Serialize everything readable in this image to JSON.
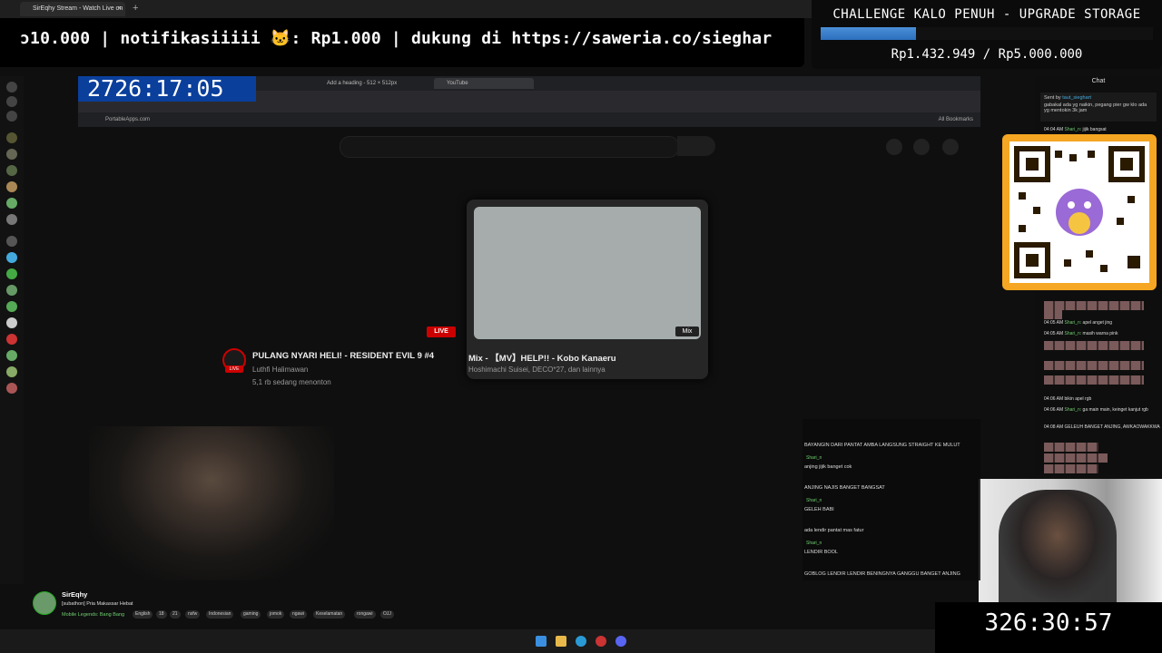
{
  "os_tab": {
    "title": "SirEqhy Stream - Watch Live on Ki",
    "close": "×",
    "new": "+"
  },
  "ticker": {
    "text": "ɔ10.000 | notifikasiiiii 🐱: Rp1.000 |  dukung di https://saweria.co/sieghar"
  },
  "challenge": {
    "title": "CHALLENGE KALO PENUH - UPGRADE STORAGE",
    "amount": "Rp1.432.949 / Rp5.000.000",
    "progress": 0.286,
    "color": "#3a7fd0"
  },
  "timer_top": "2726:17:05",
  "timer_bottom": "326:30:57",
  "browser": {
    "tabs": [
      "Add a heading - 512 × 512px",
      "YouTube"
    ],
    "bookmark": "PortableApps.com",
    "all_bookmarks": "All Bookmarks"
  },
  "youtube": {
    "mix": {
      "badge": "Mix",
      "title": "Mix - 【MV】HELP!! - Kobo Kanaeru",
      "sub": "Hoshimachi Suisei, DECO*27, dan lainnya"
    },
    "live": {
      "badge": "LIVE",
      "avatar_badge": "LIVE",
      "title": "PULANG NYARI HELI! - RESIDENT EVIL 9 #4",
      "channel": "Luthfi Halimawan",
      "viewers": "5,1 rb sedang menonton"
    }
  },
  "overlay_chat": [
    "BAYANGIN DARI PANTAT AMBA LANGSUNG STRAIGHT KE MULUT",
    "anjing jijik banget cok",
    "ANJING NAJIS BANGET BANGSAT",
    "GELEH BABI",
    "ada lendir pantat mas fatur",
    "LENDIR BOOL",
    "GOBLOG LENDIR LENDIR BENINGNYA GANGGU BANGET ANJING"
  ],
  "overlay_names": [
    "Shari_n",
    "Shari_n",
    "Shari_n"
  ],
  "right_chat": {
    "header": "Chat",
    "sent_by": "Sent by",
    "sent_user": "taut_sieghart",
    "sent_msg": "gabakal ada yg naikin, pegang pier gw klo ada yg mentokin 3k jam",
    "lines": [
      {
        "time": "04:04 AM",
        "user": "Shari_n:",
        "msg": "jijik bangsat"
      },
      {
        "time": "04:05 AM",
        "user": "Shari_n:",
        "msg": "apel anget jing"
      },
      {
        "time": "04:05 AM",
        "user": "Shari_n:",
        "msg": "masih warna pink"
      },
      {
        "time": "04:06 AM",
        "user": "",
        "msg": "bikin apel rgb"
      },
      {
        "time": "04:06 AM",
        "user": "Shari_n:",
        "msg": "ga main main, keinget kanjut rgb"
      },
      {
        "time": "04:08 AM",
        "user": "",
        "msg": "GELEUH BANGET ANJING, AWKAOWAKKWA"
      }
    ]
  },
  "streamer": {
    "name": "SirEqhy",
    "title": "[subathon] Pria Makassar Hebat",
    "game": "Mobile Legends: Bang Bang",
    "tags": [
      "English",
      "18",
      "21",
      "nsfw",
      "Indonesian",
      "gaming",
      "jomok",
      "ngawi",
      "Keselamatan",
      "rongawi",
      "OJJ"
    ]
  }
}
